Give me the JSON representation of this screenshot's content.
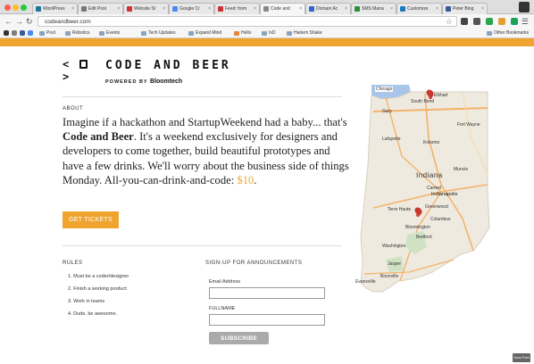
{
  "browser": {
    "tabs": [
      {
        "title": "WordPress",
        "color": "#21759b"
      },
      {
        "title": "Edit Post",
        "color": "#777777"
      },
      {
        "title": "Website St",
        "color": "#cc3333"
      },
      {
        "title": "Google Cr",
        "color": "#4a8af4"
      },
      {
        "title": "Feed: from",
        "color": "#cc3333"
      },
      {
        "title": "Code and",
        "color": "#888888",
        "active": true
      },
      {
        "title": "Domain Ac",
        "color": "#3366cc"
      },
      {
        "title": "SMS Mana",
        "color": "#2d8f3c"
      },
      {
        "title": "Customize",
        "color": "#1a7bbf"
      },
      {
        "title": "Peter Bing",
        "color": "#3b5998"
      }
    ],
    "url": "codeandbeer.com",
    "bookmarks": [
      "Post",
      "Robotics",
      "Events",
      "Tech Updates",
      "Expand Mind",
      "Hello",
      "IxD",
      "Harlem Shake"
    ],
    "other_bookmarks": "Other Bookmarks",
    "colors": {
      "accent": "#f0a430"
    }
  },
  "page": {
    "logo": {
      "glyph": "<  >",
      "title": "CODE AND BEER",
      "powered_by": "POWERED BY",
      "brand_bold": "Bloom",
      "brand_rest": "tech"
    },
    "about": {
      "label": "ABOUT",
      "text_1": "Imagine if a hackathon and StartupWeekend had a baby... that's ",
      "text_bold": "Code and Beer",
      "text_2": ". It's a weekend exclusively for designers and developers to come together, build beautiful prototypes and have a few drinks. We'll worry about the business side of things Monday. All-you-can-drink-and-code: ",
      "price": "$10",
      "text_end": "."
    },
    "tickets_button": "GET TICKETS",
    "rules": {
      "label": "RULES",
      "items": [
        "1.  Must be a coder/designer",
        "2.  Finish a working product",
        "3.  Work in teams",
        "4.  Dude, be awesome."
      ]
    },
    "signup": {
      "label": "SIGN-UP FOR ANNOUNCEMENTS",
      "email_label": "Email Address",
      "email_value": "",
      "name_label": "FULLNAME",
      "name_value": "",
      "subscribe_button": "SUBSCRIBE"
    },
    "map": {
      "state": "Indiana",
      "cities": [
        "Chicago",
        "South Bend",
        "Gary",
        "Elkhart",
        "Fort Wayne",
        "Lafayette",
        "Muncie",
        "Kokomo",
        "Carmel",
        "Indianapolis",
        "Greenwood",
        "Terre Haute",
        "Columbus",
        "Bloomington",
        "Bedford",
        "Washington",
        "Jasper",
        "Evansville",
        "Boonville"
      ]
    },
    "corner_badge": "Nova Point"
  }
}
